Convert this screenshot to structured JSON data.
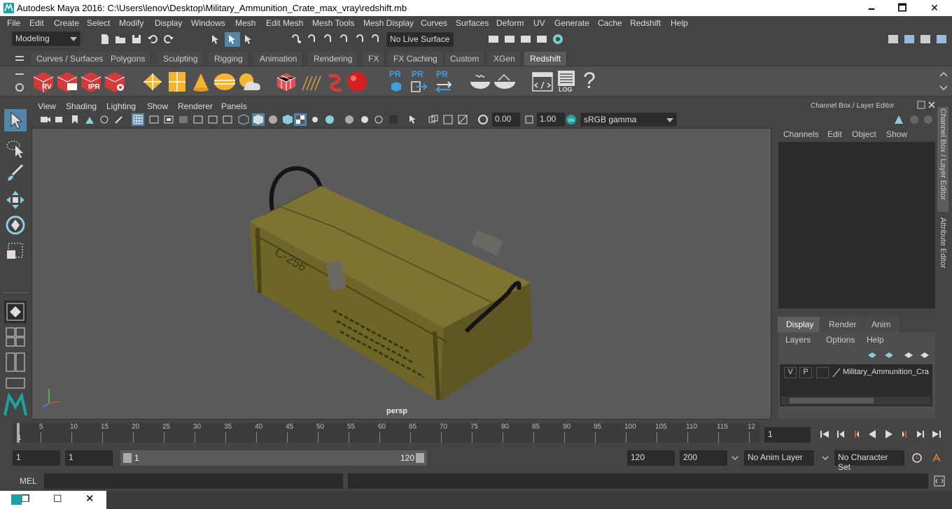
{
  "window": {
    "title": "Autodesk Maya 2016: C:\\Users\\lenov\\Desktop\\Military_Ammunition_Crate_max_vray\\redshift.mb",
    "minimize": "🗕",
    "maximize": "🗖",
    "close": "✕"
  },
  "menubar": [
    "File",
    "Edit",
    "Create",
    "Select",
    "Modify",
    "Display",
    "Windows",
    "Mesh",
    "Edit Mesh",
    "Mesh Tools",
    "Mesh Display",
    "Curves",
    "Surfaces",
    "Deform",
    "UV",
    "Generate",
    "Cache",
    "Redshift",
    "Help"
  ],
  "statusline": {
    "mode": "Modeling",
    "live_surface": "No Live Surface"
  },
  "shelf_tabs": [
    "Curves / Surfaces",
    "Polygons",
    "Sculpting",
    "Rigging",
    "Animation",
    "Rendering",
    "FX",
    "FX Caching",
    "Custom",
    "XGen",
    "Redshift"
  ],
  "shelf_active": "Redshift",
  "shelf_icons": {
    "rv": "RV",
    "ipr": "IPR",
    "pr": "PR",
    "log": "LOG",
    "help": "?"
  },
  "panel_menu": [
    "View",
    "Shading",
    "Lighting",
    "Show",
    "Renderer",
    "Panels"
  ],
  "panel_toolbar": {
    "exposure": "0.00",
    "gamma": "1.00",
    "colorspace": "sRGB gamma"
  },
  "viewport": {
    "camera_label": "persp",
    "crate_text": "C-256"
  },
  "channel_box": {
    "title": "Channel Box / Layer Editor",
    "menu": [
      "Channels",
      "Edit",
      "Object",
      "Show"
    ],
    "layer_tabs": [
      "Display",
      "Render",
      "Anim"
    ],
    "layer_tab_active": "Display",
    "layer_menu": [
      "Layers",
      "Options",
      "Help"
    ],
    "layer": {
      "v": "V",
      "p": "P",
      "name": "Military_Ammunition_Cra"
    }
  },
  "side_tabs": [
    "Channel Box / Layer Editor",
    "Attribute Editor"
  ],
  "timeline": {
    "ticks": [
      "5",
      "10",
      "15",
      "20",
      "25",
      "30",
      "35",
      "40",
      "45",
      "50",
      "55",
      "60",
      "65",
      "70",
      "75",
      "80",
      "85",
      "90",
      "95",
      "100",
      "105",
      "110",
      "115",
      "12"
    ],
    "current_marker": "1",
    "current_frame": "1"
  },
  "range": {
    "start": "1",
    "playback_start": "1",
    "slider_start": "1",
    "slider_end": "120",
    "playback_end": "120",
    "end": "200",
    "anim_layer": "No Anim Layer",
    "character_set": "No Character Set"
  },
  "cmdline": {
    "label": "MEL"
  },
  "colors": {
    "bg": "#444444",
    "viewport": "#5a5a5a",
    "accent": "#5285a6",
    "red_icon": "#d33a3a"
  }
}
